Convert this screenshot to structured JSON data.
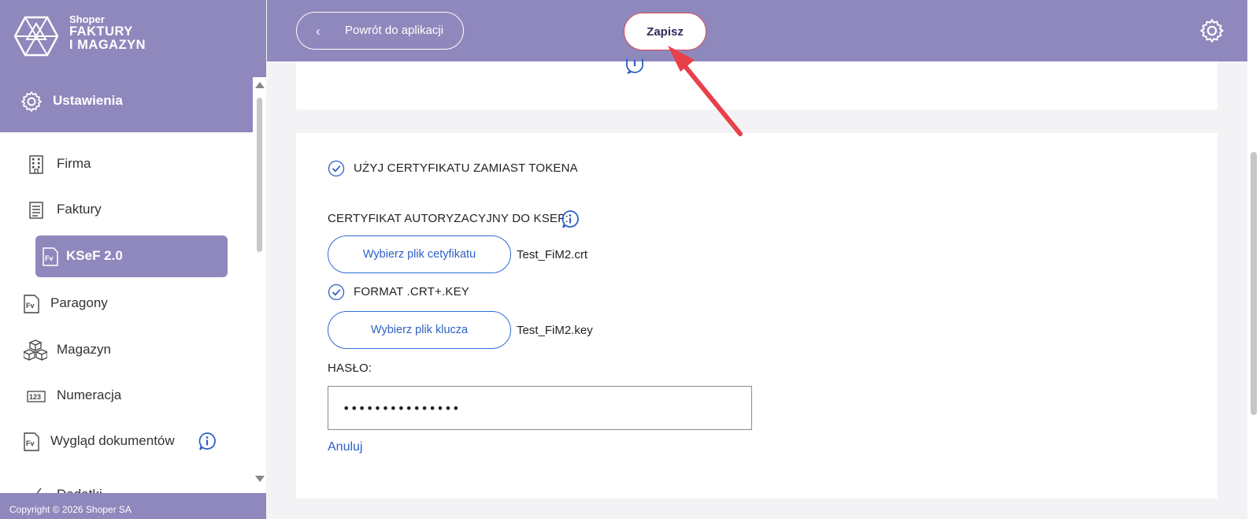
{
  "brand": {
    "small": "Shoper",
    "line1": "FAKTURY",
    "line2": "I MAGAZYN"
  },
  "sidebar": {
    "section_label": "Ustawienia",
    "items": [
      {
        "label": "Firma",
        "icon": "building-icon"
      },
      {
        "label": "Faktury",
        "icon": "document-list-icon"
      },
      {
        "label": "KSeF 2.0",
        "icon": "invoice-fv-icon",
        "active": true
      },
      {
        "label": "Paragony",
        "icon": "invoice-fv-icon"
      },
      {
        "label": "Magazyn",
        "icon": "boxes-icon"
      },
      {
        "label": "Numeracja",
        "icon": "numbering-icon"
      },
      {
        "label": "Wygląd dokumentów",
        "icon": "invoice-fv-icon"
      },
      {
        "label": "Dodatki",
        "icon": "scissors-icon"
      }
    ],
    "footer": "Copyright © 2026 Shoper SA"
  },
  "topbar": {
    "back_label": "Powrót do aplikacji",
    "save_label": "Zapisz"
  },
  "form": {
    "use_cert_label": "UŻYJ CERTYFIKATU ZAMIAST TOKENA",
    "cert_label": "CERTYFIKAT AUTORYZACYJNY DO KSEF:",
    "choose_cert_button": "Wybierz plik cetyfikatu",
    "cert_filename": "Test_FiM2.crt",
    "format_label": "FORMAT .CRT+.KEY",
    "choose_key_button": "Wybierz plik klucza",
    "key_filename": "Test_FiM2.key",
    "password_label": "HASŁO:",
    "password_value": "•••••••••••••••",
    "cancel_label": "Anuluj"
  },
  "colors": {
    "brand_purple": "#8f88bc",
    "link_blue": "#2e60c5",
    "accent_red": "#e8404b"
  }
}
